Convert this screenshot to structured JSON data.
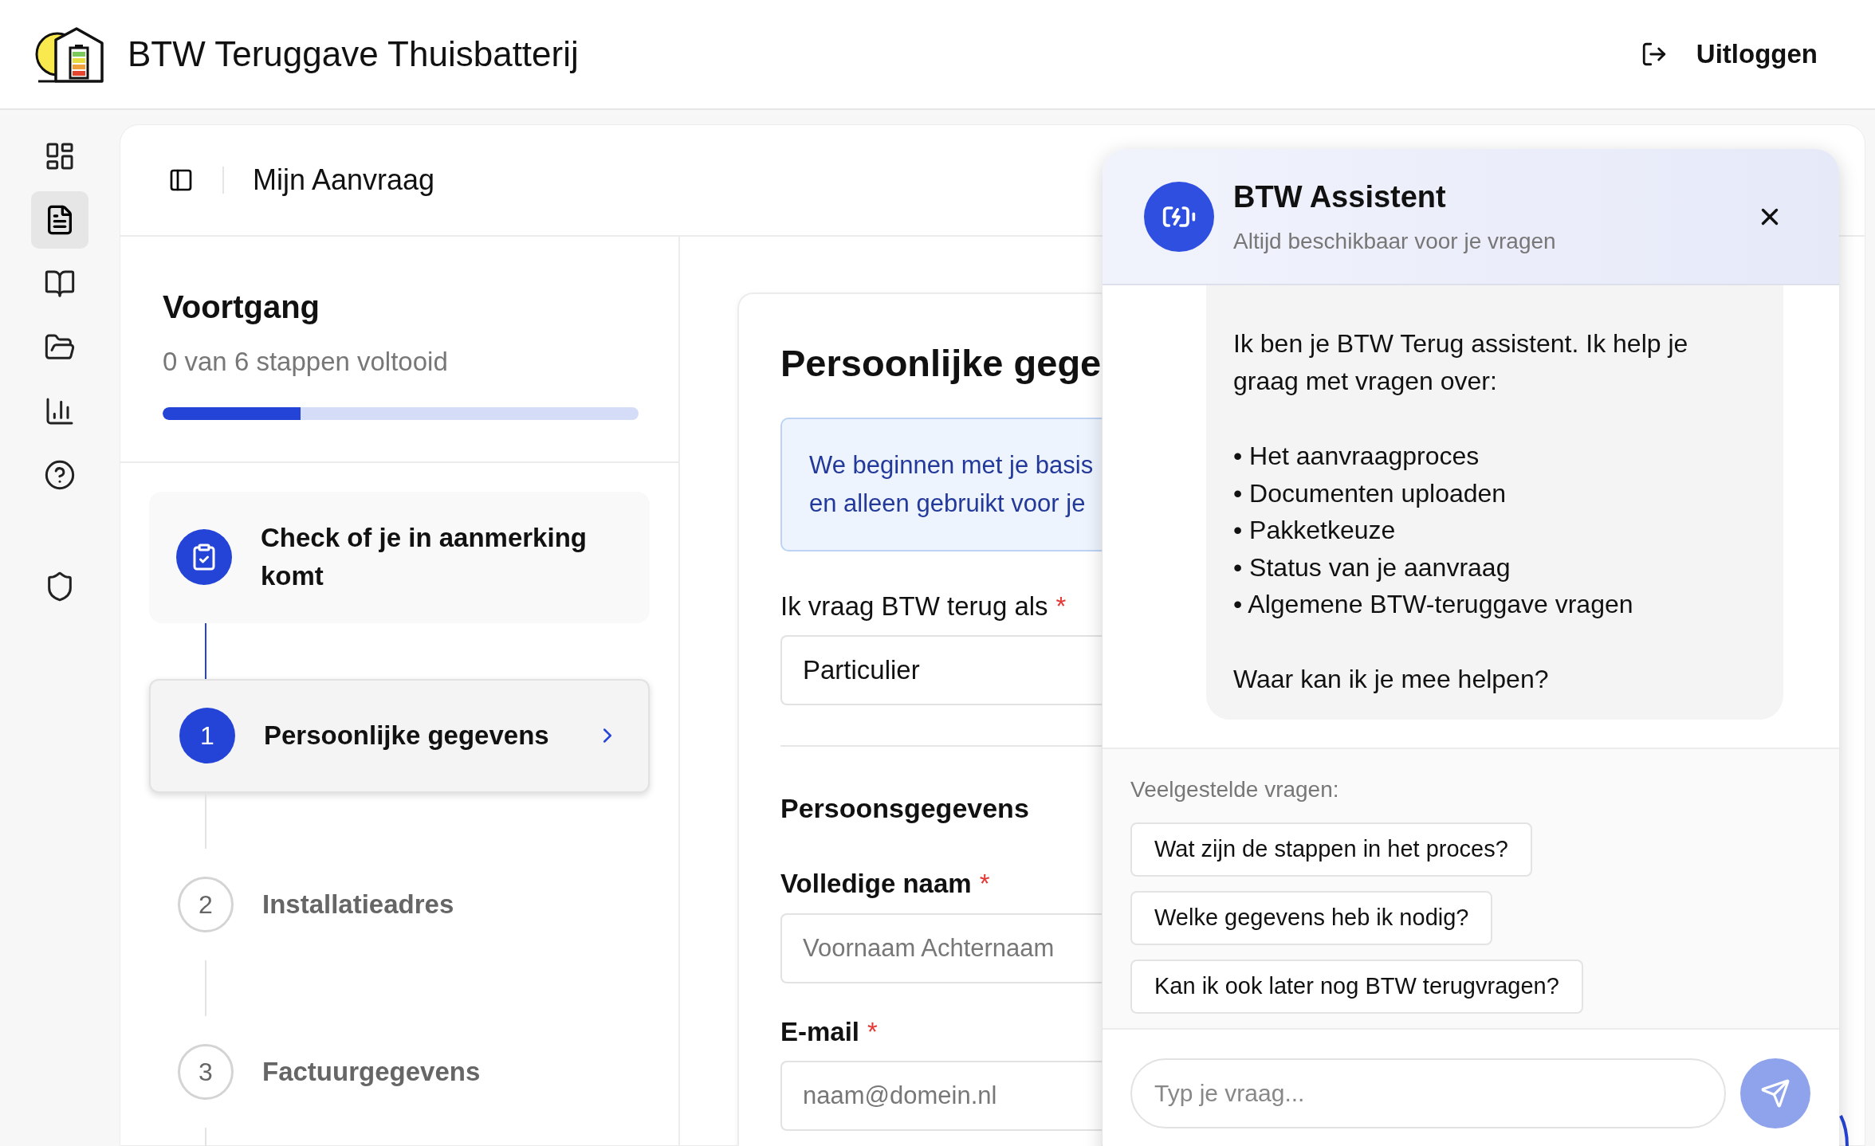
{
  "header": {
    "app_title": "BTW Teruggave Thuisbatterij",
    "logout": "Uitloggen"
  },
  "nav_rail": [
    {
      "kind": "dashboard",
      "selected": false
    },
    {
      "kind": "document",
      "selected": true
    },
    {
      "kind": "book",
      "selected": false
    },
    {
      "kind": "folder",
      "selected": false
    },
    {
      "kind": "chart",
      "selected": false
    },
    {
      "kind": "help",
      "selected": false
    },
    {
      "kind": "shield",
      "selected": false
    }
  ],
  "page_title": "Mijn Aanvraag",
  "progress": {
    "title": "Voortgang",
    "subtitle": "0 van 6 stappen voltooid",
    "level": 0.29
  },
  "steps": [
    {
      "kind": "check",
      "label": "Check of je in aanmerking komt",
      "selected": false
    },
    {
      "kind": "numbered",
      "number": "1",
      "label": "Persoonlijke gegevens",
      "selected": true
    },
    {
      "kind": "numbered",
      "number": "2",
      "label": "Installatieadres",
      "selected": false
    },
    {
      "kind": "numbered",
      "number": "3",
      "label": "Factuurgegevens",
      "selected": false
    }
  ],
  "form": {
    "title": "Persoonlijke gege",
    "info_lines": [
      "We beginnen met je basis",
      "en alleen gebruikt voor je"
    ],
    "fields": [
      {
        "kind": "select",
        "label": "Ik vraag BTW terug als",
        "required": "*",
        "value": "Particulier"
      },
      {
        "kind": "heading",
        "label": "Persoonsgegevens"
      },
      {
        "kind": "text",
        "label": "Volledige naam",
        "required": "*",
        "placeholder": "Voornaam Achternaam"
      },
      {
        "kind": "text",
        "label": "E-mail",
        "required": "*",
        "placeholder": "naam@domein.nl"
      }
    ]
  },
  "chat": {
    "title": "BTW Assistent",
    "subtitle": "Altijd beschikbaar voor je vragen",
    "message": {
      "intro": "Ik ben je BTW Terug assistent. Ik help je graag met vragen over:",
      "bullets": [
        "• Het aanvraagproces",
        "• Documenten uploaden",
        "• Pakketkeuze",
        "• Status van je aanvraag",
        "• Algemene BTW-teruggave vragen"
      ],
      "closing": "Waar kan ik je mee helpen?"
    },
    "faq_title": "Veelgestelde vragen:",
    "faq": [
      "Wat zijn de stappen in het proces?",
      "Welke gegevens heb ik nodig?",
      "Kan ik ook later nog BTW terugvragen?"
    ],
    "input": {
      "placeholder": "Typ je vraag..."
    }
  }
}
